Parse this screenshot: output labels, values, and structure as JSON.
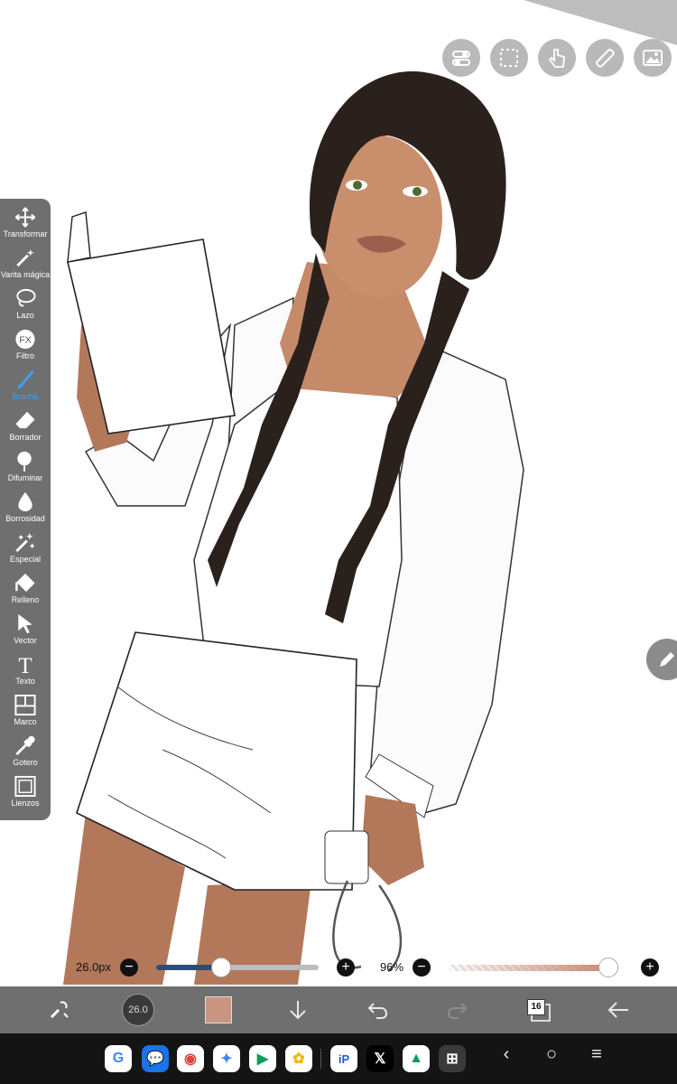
{
  "colors": {
    "toolbar_bg": "#6f6f6f",
    "active_tool": "#3aa0ff",
    "bottom_bar_bg": "#6f6f6f",
    "nav_bg": "#141414",
    "current_color": "#c99580",
    "size_slider_fill": "#2b4d7a"
  },
  "top_buttons": [
    {
      "icon": "toggle-icon"
    },
    {
      "icon": "selection-icon"
    },
    {
      "icon": "hand-gesture-icon"
    },
    {
      "icon": "ruler-icon"
    },
    {
      "icon": "image-icon"
    }
  ],
  "tools": [
    {
      "label": "Transformar",
      "icon": "move-arrows-icon"
    },
    {
      "label": "Varita mágica",
      "icon": "magic-wand-icon"
    },
    {
      "label": "Lazo",
      "icon": "lasso-icon"
    },
    {
      "label": "Filtro",
      "icon": "fx-icon"
    },
    {
      "label": "Brocha",
      "icon": "brush-icon",
      "active": true
    },
    {
      "label": "Borrador",
      "icon": "eraser-icon"
    },
    {
      "label": "Difuminar",
      "icon": "smudge-icon"
    },
    {
      "label": "Borrosidad",
      "icon": "blur-drop-icon"
    },
    {
      "label": "Especial",
      "icon": "special-wand-icon"
    },
    {
      "label": "Relleno",
      "icon": "fill-bucket-icon"
    },
    {
      "label": "Vector",
      "icon": "cursor-arrow-icon"
    },
    {
      "label": "Texto",
      "icon": "text-icon"
    },
    {
      "label": "Marco",
      "icon": "frame-icon"
    },
    {
      "label": "Gotero",
      "icon": "eyedropper-icon"
    },
    {
      "label": "Lienzos",
      "icon": "canvas-icon"
    }
  ],
  "brush": {
    "size_label": "26.0px",
    "size_value": 26.0,
    "size_fraction": 0.4,
    "circle_label": "26.0"
  },
  "opacity": {
    "label": "96%",
    "value": 0.96
  },
  "bottom_toolbar": {
    "layers_count": "16"
  },
  "nav_apps": [
    {
      "name": "google",
      "glyph": "G"
    },
    {
      "name": "messages",
      "glyph": "💬"
    },
    {
      "name": "chrome",
      "glyph": "◉"
    },
    {
      "name": "assistant",
      "glyph": "✦"
    },
    {
      "name": "play-store",
      "glyph": "▶"
    },
    {
      "name": "photos",
      "glyph": "✿"
    },
    {
      "name": "ibispaint",
      "glyph": "iP"
    },
    {
      "name": "x",
      "glyph": "𝕏"
    },
    {
      "name": "drive",
      "glyph": "▲"
    },
    {
      "name": "scanner",
      "glyph": "⊞"
    }
  ],
  "nav_keys": {
    "back": "‹",
    "home": "○",
    "recents": "≡"
  }
}
